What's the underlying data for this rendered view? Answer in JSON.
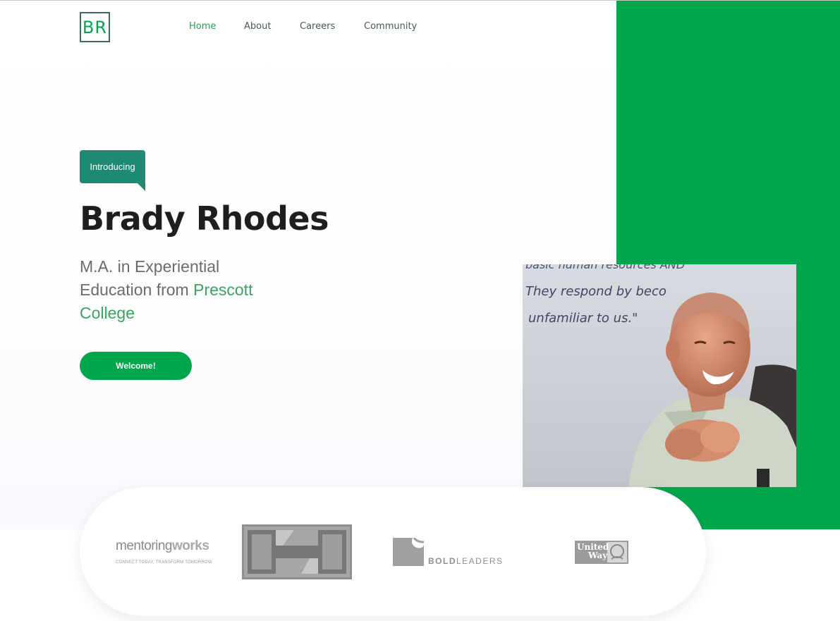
{
  "logo": {
    "text": "BR"
  },
  "nav": {
    "items": [
      {
        "label": "Home",
        "active": true
      },
      {
        "label": "About"
      },
      {
        "label": "Careers"
      },
      {
        "label": "Community"
      }
    ]
  },
  "hero": {
    "badge": "Introducing",
    "name": "Brady Rhodes",
    "subtitle_prefix": "M.A. in Experiential Education from ",
    "subtitle_highlight": "Prescott College",
    "button": "Welcome!"
  },
  "whiteboard": {
    "line1": "basic human resources AND",
    "line2": "They respond by beco",
    "line3": "unfamiliar to us.\""
  },
  "partners": {
    "mentoring_works": {
      "name_main": "mentoring",
      "name_accent": "works",
      "tagline": "CONNECT TODAY, TRANSFORM TOMORROW"
    },
    "bold_leaders": {
      "bold": "BOLD",
      "rest": "LEADERS"
    },
    "united_way": {
      "line1": "United",
      "line2": "Way"
    }
  },
  "colors": {
    "brand_green": "#00a64c",
    "badge_teal": "#1f8a73",
    "nav_active": "#2aa055",
    "highlight_green": "#3aa55e"
  }
}
